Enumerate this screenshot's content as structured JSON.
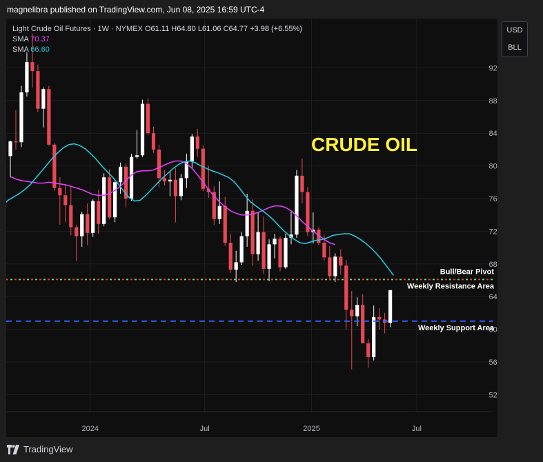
{
  "publisher": "magnelibra published on TradingView.com, Jun 08, 2025 16:59 UTC-4",
  "legend": {
    "symbol": "Light Crude Oil Futures · 1W · NYMEX",
    "o_label": "O",
    "o_value": "61.11",
    "h_label": "H",
    "h_value": "64.80",
    "l_label": "L",
    "l_value": "61.06",
    "c_label": "C",
    "c_value": "64.77",
    "change": "+3.98 (+6.55%)",
    "sma1_label": "SMA",
    "sma1_value": "70.37",
    "sma2_label": "SMA",
    "sma2_value": "66.60"
  },
  "currency": [
    "USD",
    "BLL"
  ],
  "footer": {
    "brand": "TradingView",
    "logo_icon": "tradingview-logo-icon"
  },
  "colors": {
    "up": "#ffffff",
    "down": "#e84855",
    "sma_slow": "#e040fb",
    "sma_fast": "#26c6da",
    "pivot_red": "#f23645",
    "pivot_green": "#5ee65b",
    "support": "#2962ff",
    "title_text": "#fff23a"
  },
  "chart_data": {
    "type": "candlestick",
    "title": "CRUDE  OIL",
    "ylim": [
      50.5,
      98
    ],
    "y_ticks": [
      "52.00",
      "56.00",
      "60.00",
      "64.00",
      "68.00",
      "72.00",
      "76.00",
      "80.00",
      "84.00",
      "88.00",
      "92.00"
    ],
    "x_ticks": [
      "2024",
      "Jul",
      "2025",
      "Jul"
    ],
    "annotations": [
      {
        "name": "Bull/Bear Pivot",
        "price": 66.1,
        "label": "66.10",
        "style": "dotted-red-green"
      },
      {
        "name": "Weekly Resistance Area",
        "price": 66.1,
        "label": "66.10",
        "style": "dotted-red-green"
      },
      {
        "name": "Weekly Support Area",
        "price": 61.0,
        "label": "61.00",
        "style": "dashed-blue"
      }
    ],
    "sma_slow": {
      "name": "SMA",
      "last": 70.37,
      "values": [
        78.7,
        78.4,
        78.2,
        78.1,
        78.0,
        77.9,
        77.9,
        78.0,
        77.9,
        77.8,
        77.7,
        77.5,
        77.3,
        77.1,
        76.8,
        76.5,
        76.4,
        76.4,
        76.6,
        77.0,
        77.5,
        78.2,
        78.9,
        79.3,
        79.4,
        79.4,
        79.5,
        79.8,
        80.1,
        80.4,
        80.6,
        80.6,
        80.3,
        79.7,
        78.9,
        78.0,
        77.1,
        76.3,
        75.6,
        75.0,
        74.5,
        74.2,
        74.0,
        74.0,
        74.1,
        74.3,
        74.6,
        74.9,
        75.1,
        75.1,
        74.9,
        74.5,
        73.9,
        73.2,
        72.6,
        72.0,
        71.5,
        71.0,
        70.6,
        70.37
      ]
    },
    "sma_fast": {
      "name": "SMA",
      "last": 66.6,
      "values": [
        74.3,
        75.2,
        75.8,
        76.2,
        76.6,
        77.1,
        77.7,
        78.5,
        79.3,
        80.1,
        80.9,
        81.6,
        82.2,
        82.6,
        82.7,
        82.5,
        82.1,
        81.5,
        80.8,
        80.0,
        79.3,
        78.6,
        77.8,
        76.9,
        76.1,
        75.7,
        75.8,
        76.4,
        77.1,
        77.8,
        78.5,
        79.1,
        79.7,
        80.2,
        80.5,
        80.6,
        80.4,
        80.0,
        79.7,
        79.4,
        79.2,
        78.9,
        78.6,
        78.1,
        77.3,
        76.4,
        75.6,
        75.1,
        74.6,
        74.1,
        73.5,
        72.8,
        72.1,
        71.5,
        71.0,
        70.6,
        70.5,
        70.7,
        70.9,
        71.0,
        71.2,
        71.5,
        71.6,
        71.7,
        71.7,
        71.4,
        71.0,
        70.5,
        69.9,
        69.2,
        68.4,
        67.5,
        66.6
      ]
    },
    "candles": [
      [
        81.2,
        83.1,
        78.6,
        83.0
      ],
      [
        83.0,
        86.8,
        82.0,
        82.9
      ],
      [
        82.9,
        89.8,
        82.3,
        89.0
      ],
      [
        89.0,
        93.9,
        88.5,
        92.7
      ],
      [
        92.7,
        96.2,
        89.6,
        91.6
      ],
      [
        91.6,
        92.4,
        86.6,
        87.0
      ],
      [
        87.0,
        89.6,
        84.7,
        89.4
      ],
      [
        89.4,
        89.8,
        82.5,
        82.6
      ],
      [
        82.6,
        82.8,
        76.9,
        77.3
      ],
      [
        77.3,
        78.6,
        72.8,
        76.4
      ],
      [
        76.4,
        77.8,
        73.1,
        75.2
      ],
      [
        75.2,
        77.5,
        71.5,
        72.5
      ],
      [
        72.5,
        72.8,
        68.4,
        71.4
      ],
      [
        71.4,
        74.4,
        70.1,
        74.1
      ],
      [
        74.1,
        75.4,
        70.3,
        71.8
      ],
      [
        71.8,
        75.9,
        71.3,
        75.7
      ],
      [
        75.7,
        77.1,
        71.7,
        72.9
      ],
      [
        72.9,
        79.1,
        72.6,
        78.6
      ],
      [
        78.6,
        79.6,
        73.5,
        73.7
      ],
      [
        73.7,
        78.1,
        73.1,
        78.0
      ],
      [
        78.0,
        80.4,
        76.6,
        79.9
      ],
      [
        79.9,
        80.3,
        74.9,
        76.0
      ],
      [
        76.0,
        81.5,
        75.7,
        81.1
      ],
      [
        81.1,
        84.4,
        80.9,
        81.3
      ],
      [
        81.3,
        88.1,
        81.1,
        87.6
      ],
      [
        87.6,
        88.3,
        83.8,
        84.0
      ],
      [
        84.0,
        84.8,
        81.6,
        82.0
      ],
      [
        82.0,
        82.6,
        77.4,
        78.5
      ],
      [
        78.5,
        79.5,
        77.6,
        78.1
      ],
      [
        78.1,
        79.3,
        76.3,
        78.3
      ],
      [
        78.3,
        79.7,
        73.1,
        76.3
      ],
      [
        76.3,
        79.0,
        75.8,
        78.5
      ],
      [
        78.5,
        81.5,
        77.3,
        80.6
      ],
      [
        80.6,
        83.9,
        79.7,
        83.6
      ],
      [
        83.6,
        84.5,
        81.1,
        82.1
      ],
      [
        82.1,
        82.5,
        76.9,
        77.2
      ],
      [
        77.2,
        80.0,
        76.1,
        76.8
      ],
      [
        76.8,
        77.5,
        72.8,
        73.5
      ],
      [
        73.5,
        78.1,
        72.9,
        75.1
      ],
      [
        75.1,
        76.2,
        70.2,
        70.6
      ],
      [
        70.6,
        71.7,
        66.9,
        67.3
      ],
      [
        67.3,
        69.6,
        65.8,
        68.2
      ],
      [
        68.2,
        71.9,
        67.9,
        71.4
      ],
      [
        71.4,
        76.6,
        70.1,
        74.5
      ],
      [
        74.5,
        75.9,
        67.8,
        69.2
      ],
      [
        69.2,
        74.4,
        68.4,
        71.9
      ],
      [
        71.9,
        73.8,
        66.8,
        67.4
      ],
      [
        67.4,
        71.0,
        65.9,
        70.4
      ],
      [
        70.4,
        71.7,
        68.7,
        71.1
      ],
      [
        71.1,
        71.4,
        67.1,
        67.6
      ],
      [
        67.6,
        71.7,
        67.4,
        71.2
      ],
      [
        71.2,
        74.4,
        70.4,
        71.6
      ],
      [
        71.6,
        79.5,
        71.2,
        78.8
      ],
      [
        78.8,
        80.9,
        75.4,
        76.8
      ],
      [
        76.8,
        77.4,
        71.4,
        71.9
      ],
      [
        71.9,
        74.3,
        70.5,
        72.2
      ],
      [
        72.2,
        72.5,
        70.3,
        70.6
      ],
      [
        70.6,
        71.6,
        68.4,
        68.8
      ],
      [
        68.8,
        70.2,
        66.0,
        66.5
      ],
      [
        66.5,
        69.3,
        65.8,
        68.9
      ],
      [
        68.9,
        69.8,
        66.7,
        67.8
      ],
      [
        67.8,
        68.5,
        60.0,
        62.4
      ],
      [
        62.4,
        64.7,
        55.1,
        61.6
      ],
      [
        61.6,
        63.9,
        60.4,
        63.0
      ],
      [
        63.0,
        64.3,
        58.4,
        58.3
      ],
      [
        58.3,
        58.8,
        55.3,
        56.6
      ],
      [
        56.6,
        62.9,
        56.2,
        61.5
      ],
      [
        61.5,
        62.6,
        60.0,
        61.2
      ],
      [
        61.2,
        62.0,
        59.5,
        60.8
      ],
      [
        60.8,
        64.8,
        60.3,
        64.8
      ]
    ]
  }
}
